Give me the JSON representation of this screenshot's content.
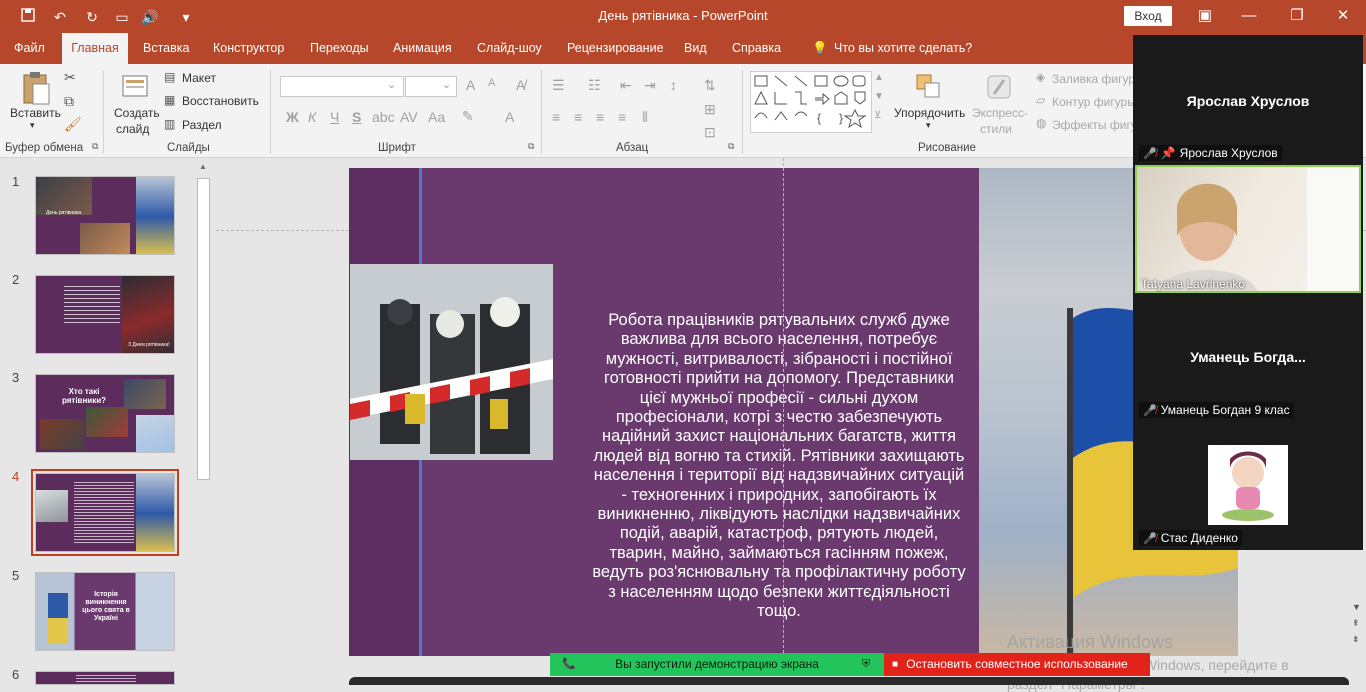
{
  "window": {
    "title": "День рятівника  -  PowerPoint",
    "signin": "Вход"
  },
  "tabs": [
    "Файл",
    "Главная",
    "Вставка",
    "Конструктор",
    "Переходы",
    "Анимация",
    "Слайд-шоу",
    "Рецензирование",
    "Вид",
    "Справка",
    "Что вы хотите сделать?"
  ],
  "ribbon": {
    "paste": "Вставить",
    "clipboard_group": "Буфер обмена",
    "new_slide_line1": "Создать",
    "new_slide_line2": "слайд",
    "layout": "Макет",
    "reset": "Восстановить",
    "section": "Раздел",
    "slides_group": "Слайды",
    "font_group": "Шрифт",
    "bold": "Ж",
    "italic": "К",
    "underline": "Ч",
    "strike": "S",
    "paragraph_group": "Абзац",
    "arrange": "Упорядочить",
    "quick_styles_line1": "Экспресс-",
    "quick_styles_line2": "стили",
    "shape_fill": "Заливка фигур",
    "shape_outline": "Контур фигуры",
    "shape_effects": "Эффекты фигу",
    "drawing_group": "Рисование"
  },
  "thumbnails": [
    {
      "num": "1",
      "caption": "День рятівника"
    },
    {
      "num": "2",
      "caption": "З Днем рятівника!"
    },
    {
      "num": "3",
      "caption": "Хто такі рятівники?"
    },
    {
      "num": "4",
      "caption": ""
    },
    {
      "num": "5",
      "caption": "Історія виникнення цього свята в Україні"
    },
    {
      "num": "6",
      "caption": ""
    }
  ],
  "slide": {
    "body": "Робота працівників рятувальних служб дуже важлива для всього населення, потребує мужності, витривалості, зібраності і постійної готовності прийти на допомогу. Представники цієї мужньої професії - сильні духом професіонали, котрі з честю забезпечують надійний захист національних багатств, життя людей від вогню та стихій. Рятівники захищають населення і території від надзвичайних ситуацій - техногенних і природних, запобігають їх виникненню, ліквідують наслідки надзвичайних подій, аварій, катастроф, рятують людей, тварин, майно, займаються гасінням пожеж, ведуть роз'яснювальну та профілактичну роботу з населенням щодо безпеки життєдіяльності тощо."
  },
  "zoom": {
    "p1_big": "Ярослав Хруслов",
    "p1_label": "Ярослав Хруслов",
    "p2_label": "Tatyana Lavrinenko",
    "p3_big": "Уманець  Богда...",
    "p3_label": "Уманець Богдан 9 клас",
    "p4_label": "Стас Диденко"
  },
  "share": {
    "status": "Вы запустили демонстрацию экрана",
    "stop": "Остановить совместное использование"
  },
  "activation": {
    "line1": "Активация Windows",
    "line2": "Чтобы активировать Windows, перейдите в",
    "line3": "раздел \"Параметры\"."
  }
}
